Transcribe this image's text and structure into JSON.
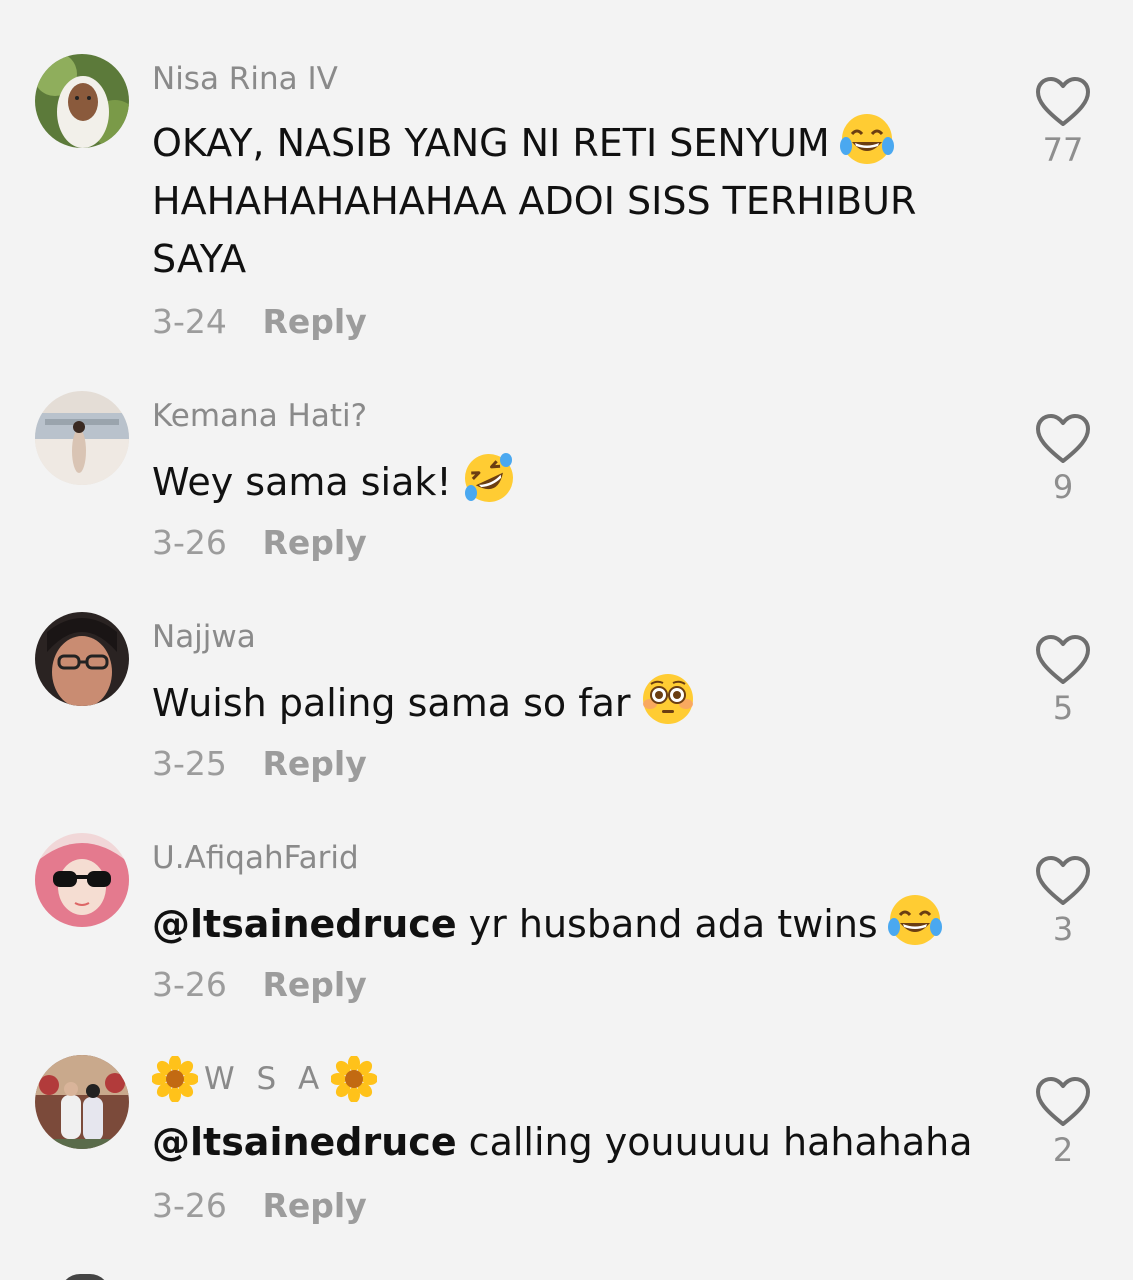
{
  "comments": [
    {
      "username": "Nisa Rina IV",
      "text": "OKAY, NASIB YANG NI RETI SENYUM",
      "text_line2": "HAHAHAHAHAHAA ADOI SISS TERHIBUR",
      "text_line3": "SAYA",
      "emoji": "face-with-tears-of-joy",
      "date": "3-24",
      "reply": "Reply",
      "likes": "77"
    },
    {
      "username": "Kemana Hati?",
      "text": "Wey sama siak!",
      "emoji": "rolling-on-floor-laughing",
      "date": "3-26",
      "reply": "Reply",
      "likes": "9"
    },
    {
      "username": "Najjwa",
      "text": "Wuish paling sama so far",
      "emoji": "flushed-face",
      "date": "3-25",
      "reply": "Reply",
      "likes": "5"
    },
    {
      "username": "U.AfiqahFarid",
      "mention": "@ltsainedruce",
      "text": " yr husband ada twins",
      "emoji": "face-with-tears-of-joy",
      "date": "3-26",
      "reply": "Reply",
      "likes": "3"
    },
    {
      "username": "W S A",
      "username_emoji": "sunflower",
      "mention": "@ltsainedruce",
      "text": " calling youuuuu hahahaha",
      "date": "3-26",
      "reply": "Reply",
      "likes": "2"
    }
  ],
  "colors": {
    "background": "#f3f3f3",
    "username": "#8a8a8a",
    "body_text": "#111111",
    "meta": "#9c9c9c",
    "heart_outline": "#6f6f6f"
  }
}
